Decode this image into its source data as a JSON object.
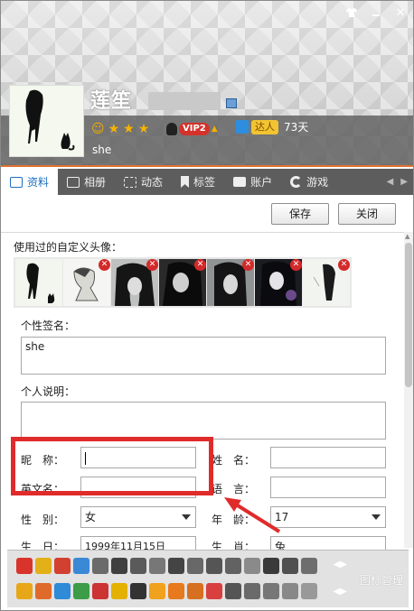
{
  "window": {
    "skin_icon": "shirt-icon",
    "close_glyph": "✕"
  },
  "profile": {
    "nickname": "莲笙",
    "signature": "she",
    "vip_label": "VIP2",
    "daren_label": "达人",
    "days": "73天"
  },
  "tabs": [
    {
      "label": "资料",
      "icon": "profile-card-icon",
      "active": true
    },
    {
      "label": "相册",
      "icon": "photo-album-icon"
    },
    {
      "label": "动态",
      "icon": "feed-icon"
    },
    {
      "label": "标签",
      "icon": "bookmark-icon"
    },
    {
      "label": "账户",
      "icon": "wallet-icon"
    },
    {
      "label": "游戏",
      "icon": "game-icon"
    }
  ],
  "toolbar": {
    "save_label": "保存",
    "close_label": "关闭"
  },
  "form": {
    "used_avatars_label": "使用过的自定义头像：",
    "signature_label": "个性签名：",
    "signature_value": "she",
    "description_label": "个人说明：",
    "nickname_label": "昵　称：",
    "nickname_value": "",
    "name_label": "姓　名：",
    "english_name_label": "英文名：",
    "language_label": "语　言：",
    "gender_label": "性　别：",
    "gender_value": "女",
    "age_label": "年　龄：",
    "age_value": "17",
    "birthday_label": "生　日：",
    "birthday_value": "1999年11月15日",
    "zodiac_label": "生　肖：",
    "zodiac_value": "兔"
  },
  "iconbar": {
    "manage_label": "图标管理"
  },
  "colors": {
    "accent": "#e0712f",
    "tab_active": "#1d6fbf",
    "annotation_red": "#e02b2b"
  }
}
